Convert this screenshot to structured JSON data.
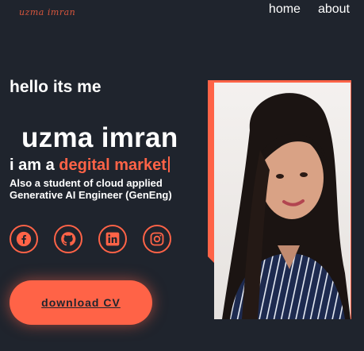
{
  "logo": {
    "text": "uzma imran"
  },
  "nav": {
    "items": [
      {
        "label": "home"
      },
      {
        "label": "about"
      }
    ]
  },
  "hero": {
    "greeting": "hello its me",
    "name": "uzma imran",
    "role_prefix": "i am a",
    "role_highlight": "degital market",
    "tagline_line1": "Also a student of cloud applied",
    "tagline_line2": "Generative AI Engineer (GenEng)"
  },
  "socials": [
    {
      "icon": "facebook-icon"
    },
    {
      "icon": "github-icon"
    },
    {
      "icon": "linkedin-icon"
    },
    {
      "icon": "instagram-icon"
    }
  ],
  "cta": {
    "label": "download CV"
  },
  "colors": {
    "background": "#1f242d",
    "accent": "#ff6347",
    "text": "#ffffff"
  }
}
